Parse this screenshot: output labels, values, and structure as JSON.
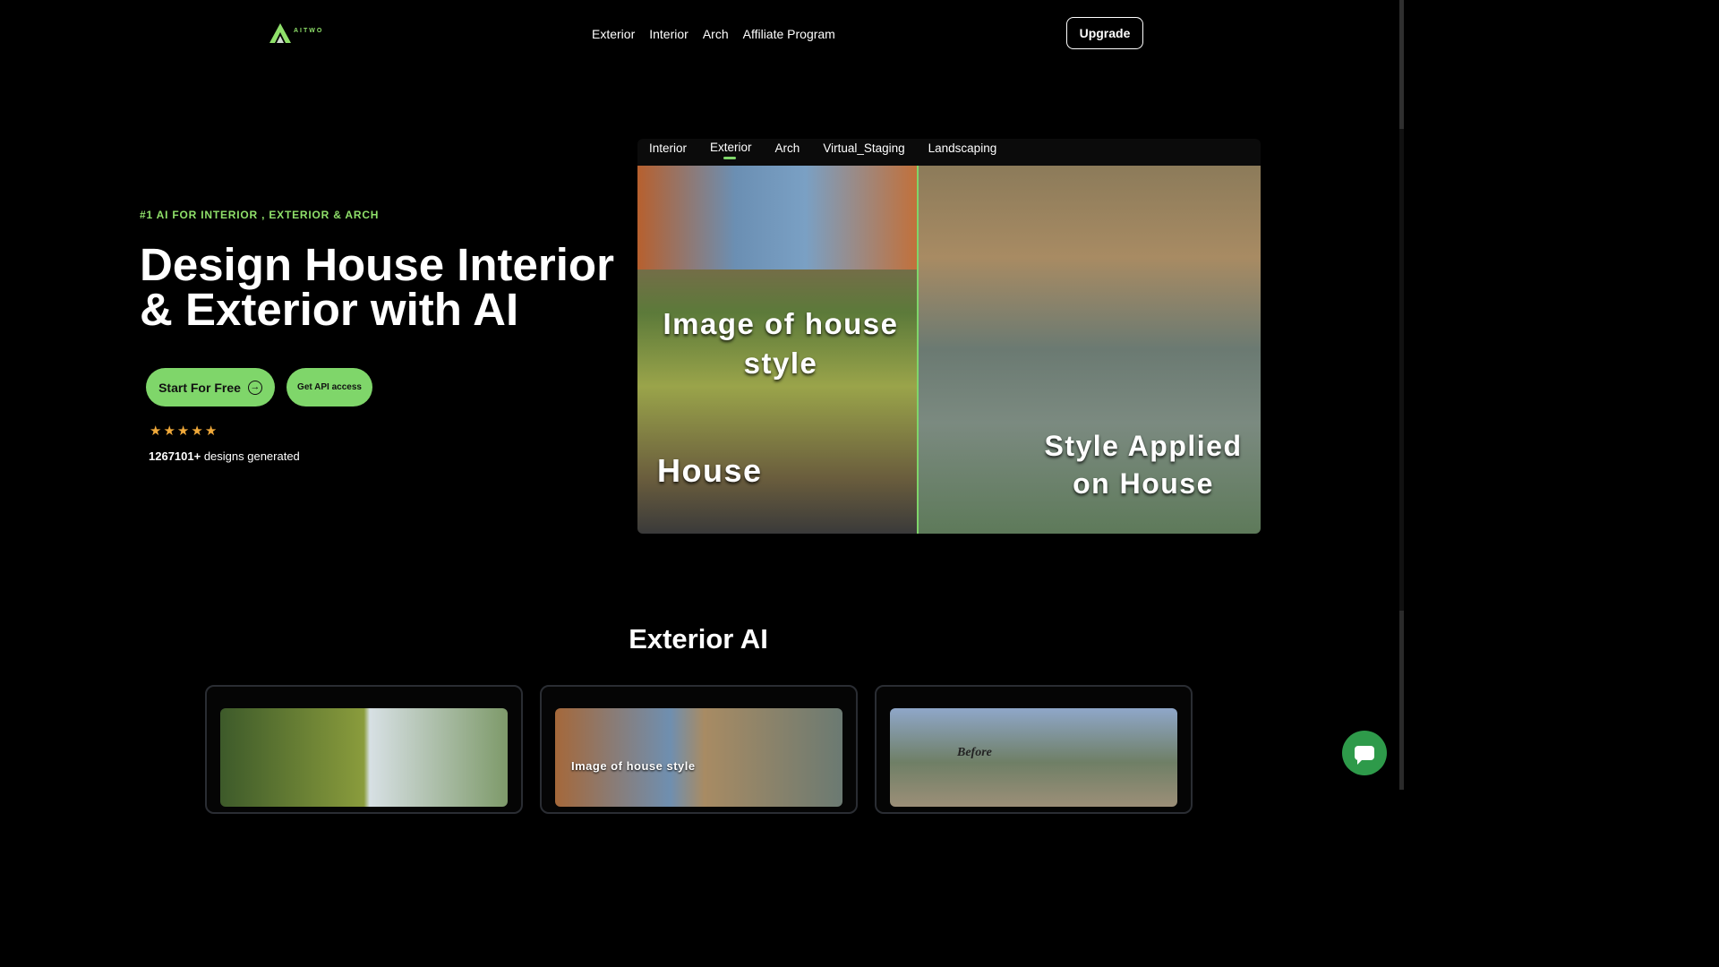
{
  "header": {
    "logo_text": "AITWO",
    "nav": [
      "Exterior",
      "Interior",
      "Arch",
      "Affiliate Program"
    ],
    "upgrade_label": "Upgrade"
  },
  "hero": {
    "kicker": "#1 AI FOR INTERIOR , EXTERIOR & ARCH",
    "title": "Design House Interior & Exterior with AI",
    "start_label": "Start For Free",
    "api_label": "Get API access",
    "rating_stars": 5,
    "designs_count": "1267101+",
    "designs_suffix": " designs generated"
  },
  "showcase": {
    "tabs": [
      "Interior",
      "Exterior",
      "Arch",
      "Virtual_Staging",
      "Landscaping"
    ],
    "active_tab": "Exterior",
    "caption_style": "Image of house style",
    "caption_house": "House",
    "caption_applied": "Style Applied on House"
  },
  "section": {
    "title": "Exterior AI",
    "cards": [
      {
        "caption": ""
      },
      {
        "caption": "Image of house style"
      },
      {
        "caption": "Before"
      }
    ]
  },
  "colors": {
    "accent": "#7fd66a",
    "star": "#f0a93a",
    "chat": "#2e9a4a",
    "background": "#000000"
  }
}
